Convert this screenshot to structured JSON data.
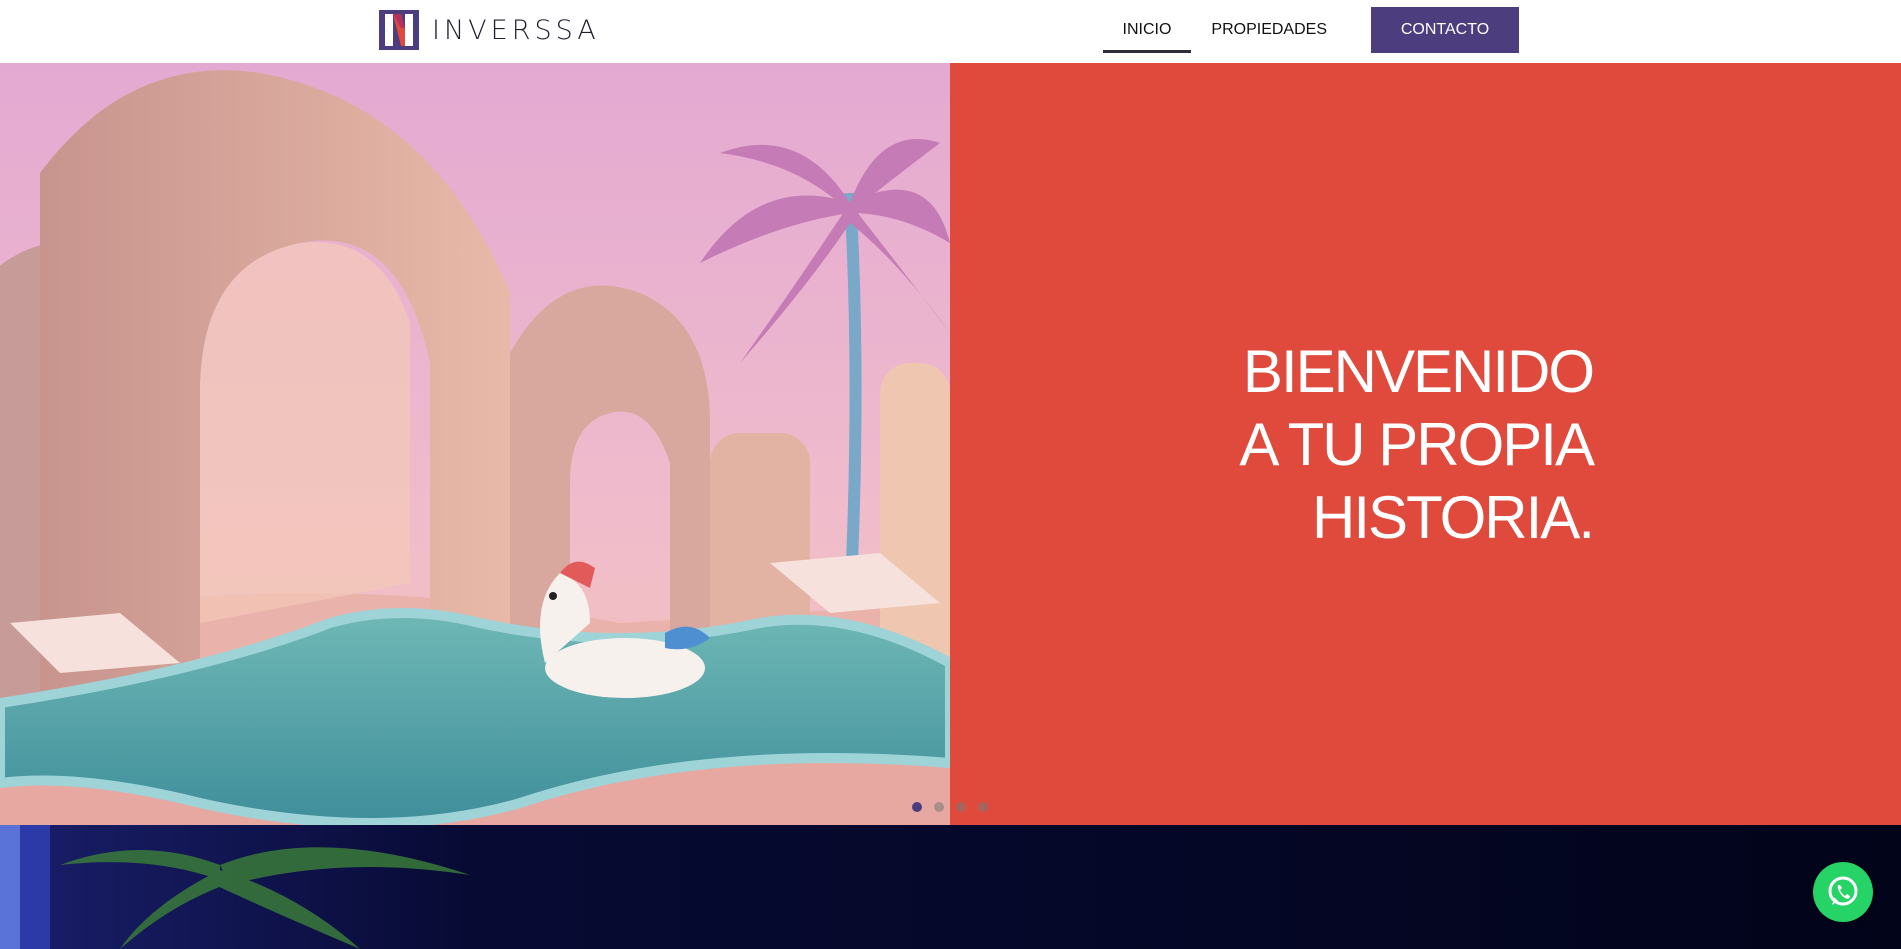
{
  "header": {
    "brand": "INVERSSA",
    "nav": {
      "inicio": "INICIO",
      "propiedades": "PROPIEDADES",
      "contacto": "CONTACTO"
    }
  },
  "hero": {
    "title_line_1": "BIENVENIDO",
    "title_line_2": "A TU PROPIA",
    "title_line_3": "HISTORIA.",
    "slide_count": 4,
    "active_slide": 1
  },
  "colors": {
    "brand_purple": "#4b3d7e",
    "hero_red": "#df4a3c",
    "whatsapp_green": "#25d366",
    "dark_section": "#020418"
  },
  "icons": {
    "logo": "inverssa-n-logo",
    "whatsapp": "whatsapp-icon"
  }
}
